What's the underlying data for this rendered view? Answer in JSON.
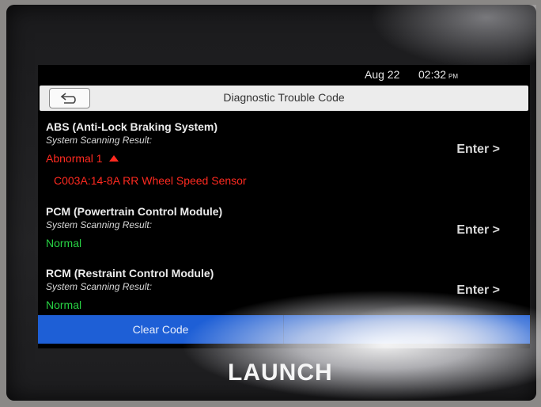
{
  "statusbar": {
    "date": "Aug 22",
    "time": "02:32",
    "ampm": "PM"
  },
  "header": {
    "title": "Diagnostic Trouble Code"
  },
  "modules": [
    {
      "name": "ABS (Anti-Lock Braking System)",
      "scan_label": "System Scanning Result:",
      "status": "Abnormal 1",
      "dtc": "C003A:14-8A RR Wheel Speed Sensor",
      "enter": "Enter >"
    },
    {
      "name": "PCM (Powertrain Control Module)",
      "scan_label": "System Scanning Result:",
      "status": "Normal",
      "enter": "Enter >"
    },
    {
      "name": "RCM (Restraint Control Module)",
      "scan_label": "System Scanning Result:",
      "status": "Normal",
      "enter": "Enter >"
    }
  ],
  "footer": {
    "clear_label": "Clear Code"
  },
  "brand": "LAUNCH",
  "colors": {
    "accent": "#1e5fd6",
    "abnormal": "#ff2a20",
    "normal": "#28d244"
  },
  "icons": {
    "back": "back-arrow-icon",
    "abnormal_indicator": "triangle-up-icon"
  }
}
